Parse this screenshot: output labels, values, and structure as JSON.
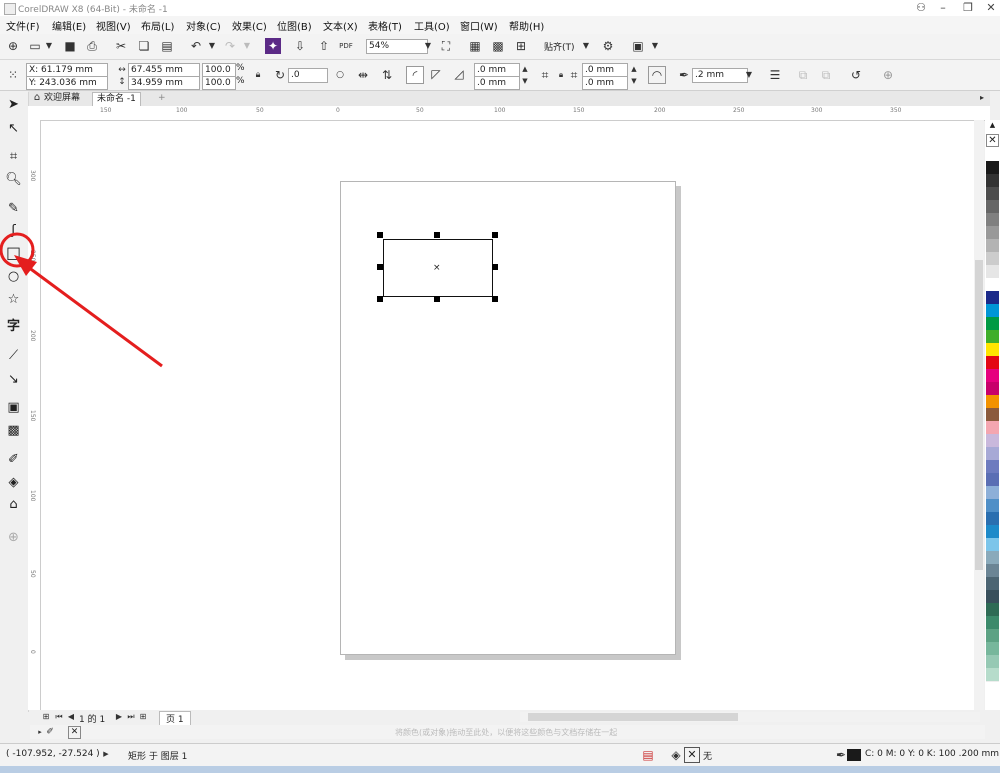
{
  "app_title": "CorelDRAW X8 (64-Bit) - 未命名 -1",
  "menu": [
    "文件(F)",
    "编辑(E)",
    "视图(V)",
    "布局(L)",
    "对象(C)",
    "效果(C)",
    "位图(B)",
    "文本(X)",
    "表格(T)",
    "工具(O)",
    "窗口(W)",
    "帮助(H)"
  ],
  "toolbar": {
    "zoom": "54%",
    "snap_label": "贴齐(T)",
    "pdf_label": "PDF"
  },
  "property_bar": {
    "x": "X: 61.179 mm",
    "y": "Y: 243.036 mm",
    "width": "67.455 mm",
    "height": "34.959 mm",
    "scale_w": "100.0",
    "scale_h": "100.0",
    "percent": "%",
    "rotation": ".0",
    "corner_1": ".0 mm",
    "corner_2": ".0 mm",
    "corner_3": ".0 mm",
    "corner_4": ".0 mm",
    "outline_width": ".2 mm"
  },
  "tabs": {
    "welcome": "欢迎屏幕",
    "doc": "未命名 -1",
    "add": "+"
  },
  "hruler_labels": [
    "150",
    "100",
    "50",
    "0",
    "50",
    "100",
    "150",
    "200",
    "250",
    "300",
    "350"
  ],
  "vruler_labels": [
    "300",
    "250",
    "200",
    "150",
    "100",
    "50",
    "0"
  ],
  "page_nav": {
    "page_count": "1 的 1",
    "page_tab": "页 1"
  },
  "hint_text": "将颜色(或对象)拖动至此处，以便将这些颜色与文档存储在一起",
  "status": {
    "coords": "( -107.952, -27.524 )",
    "object_info": "矩形 于 图层 1",
    "fill_none": "无",
    "outline_info": "C: 0 M: 0 Y: 0 K: 100  .200 mm"
  },
  "palette_colors": [
    "#ffffff",
    "#1a1a1a",
    "#333333",
    "#4d4d4d",
    "#666666",
    "#808080",
    "#999999",
    "#b3b3b3",
    "#cccccc",
    "#e6e6e6",
    "#ffffff",
    "#1b2a8a",
    "#0096d6",
    "#009a44",
    "#3fae2a",
    "#ffe500",
    "#e30613",
    "#e6007e",
    "#c8006a",
    "#f39200",
    "#8b5a3c",
    "#f4a6b0",
    "#c9b8dc",
    "#a7a9d6",
    "#6d7bbf",
    "#5a6eb4",
    "#8dafd8",
    "#4f8fc7",
    "#2a6fb0",
    "#1d8ac9",
    "#7cc5ea",
    "#8aaabb",
    "#6b8595",
    "#4c6573",
    "#384f5b",
    "#2e6b55",
    "#3c8a6b",
    "#5da284",
    "#77b79c",
    "#96c9b4",
    "#b6dccb"
  ],
  "accent": {
    "annotation_red": "#e41e1e"
  }
}
